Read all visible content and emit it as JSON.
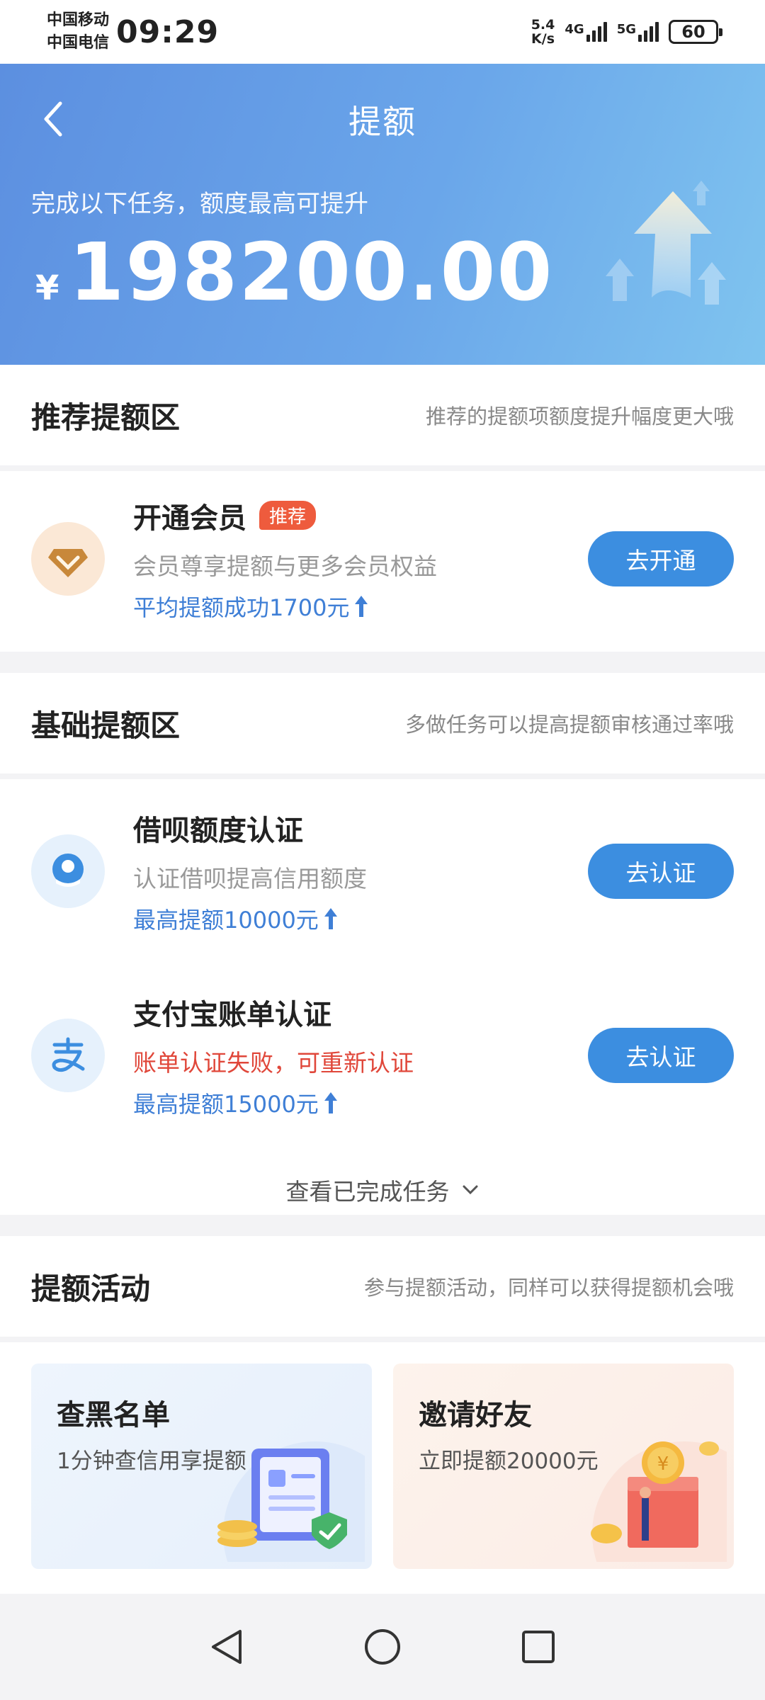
{
  "status_bar": {
    "carrier1": "中国移动",
    "carrier2": "中国电信",
    "time": "09:29",
    "net_speed_value": "5.4",
    "net_speed_unit": "K/s",
    "signal1_label": "4G",
    "signal2_label": "5G",
    "battery": "60"
  },
  "header": {
    "title": "提额",
    "subtitle": "完成以下任务，额度最高可提升",
    "currency": "¥",
    "amount": "198200.00"
  },
  "recommended": {
    "title": "推荐提额区",
    "desc": "推荐的提额项额度提升幅度更大哦",
    "items": [
      {
        "name": "开通会员",
        "tag": "推荐",
        "desc": "会员尊享提额与更多会员权益",
        "hint": "平均提额成功1700元",
        "button": "去开通",
        "icon": "vip-diamond-icon"
      }
    ]
  },
  "basic": {
    "title": "基础提额区",
    "desc": "多做任务可以提高提额审核通过率哦",
    "items": [
      {
        "name": "借呗额度认证",
        "desc": "认证借呗提高信用额度",
        "hint": "最高提额10000元",
        "button": "去认证",
        "icon": "jiebei-icon"
      },
      {
        "name": "支付宝账单认证",
        "desc": "账单认证失败，可重新认证",
        "hint": "最高提额15000元",
        "button": "去认证",
        "icon": "alipay-icon"
      }
    ],
    "view_done": "查看已完成任务"
  },
  "activities": {
    "title": "提额活动",
    "desc": "参与提额活动，同样可以获得提额机会哦",
    "cards": [
      {
        "title": "查黑名单",
        "desc": "1分钟查信用享提额"
      },
      {
        "title": "邀请好友",
        "desc": "立即提额20000元"
      }
    ]
  },
  "colors": {
    "accent": "#3c8ee0",
    "hint_blue": "#3f7fd6",
    "error": "#e0473a",
    "tag": "#ee5b3d"
  }
}
